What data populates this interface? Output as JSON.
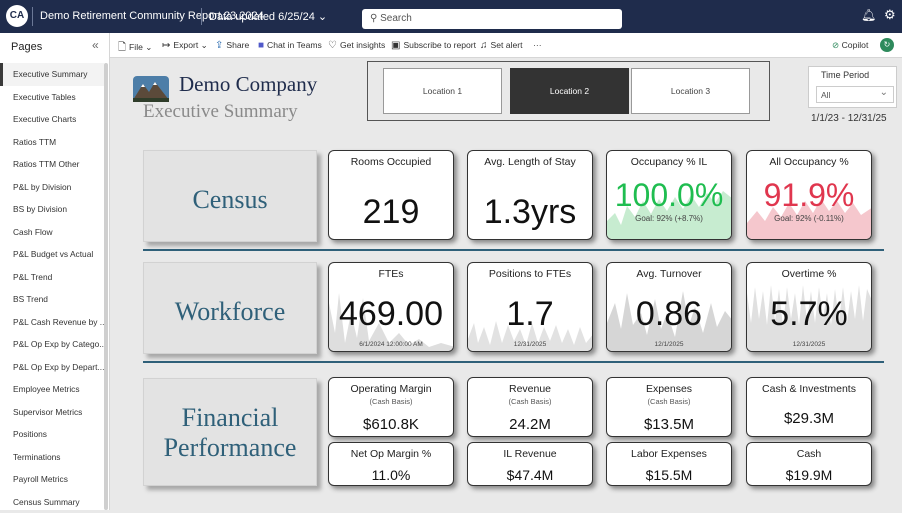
{
  "topbar": {
    "report_title": "Demo Retirement Community Report.23.2024",
    "updated": "Data updated 6/25/24",
    "search_placeholder": "Search"
  },
  "sidebar": {
    "title": "Pages",
    "items": [
      "Executive Summary",
      "Executive Tables",
      "Executive Charts",
      "Ratios TTM",
      "Ratios TTM Other",
      "P&L by Division",
      "BS by Division",
      "Cash Flow",
      "P&L Budget vs Actual",
      "P&L Trend",
      "BS Trend",
      "P&L Cash Revenue by ...",
      "P&L Op Exp by Catego...",
      "P&L Op Exp by Depart...",
      "Employee Metrics",
      "Supervisor Metrics",
      "Positions",
      "Terminations",
      "Payroll Metrics",
      "Census Summary"
    ]
  },
  "toolbar": {
    "file": "File",
    "export": "Export",
    "share": "Share",
    "teams": "Chat in Teams",
    "insights": "Get insights",
    "subscribe": "Subscribe to report",
    "alert": "Set alert",
    "more": "···",
    "copilot": "Copilot"
  },
  "header": {
    "company": "Demo Company",
    "subtitle": "Executive Summary"
  },
  "locations": [
    "Location 1",
    "Location 2",
    "Location 3"
  ],
  "selected_location": "Location 2",
  "time_period": {
    "label": "Time Period",
    "value": "All",
    "range": "1/1/23 - 12/31/25"
  },
  "sections": {
    "census": "Census",
    "workforce": "Workforce",
    "financial_1": "Financial",
    "financial_2": "Performance"
  },
  "census": {
    "rooms": {
      "title": "Rooms Occupied",
      "value": "219"
    },
    "los": {
      "title": "Avg. Length of Stay",
      "value": "1.3yrs"
    },
    "occ_il": {
      "title": "Occupancy % IL",
      "value": "100.0%",
      "goal": "Goal: 92% (+8.7%)"
    },
    "occ_all": {
      "title": "All Occupancy %",
      "value": "91.9%",
      "goal": "Goal: 92% (-0.11%)"
    }
  },
  "workforce": {
    "ftes": {
      "title": "FTEs",
      "value": "469.00",
      "date": "6/1/2024 12:00:00 AM"
    },
    "pos": {
      "title": "Positions to FTEs",
      "value": "1.7",
      "date": "12/31/2025"
    },
    "turnover": {
      "title": "Avg. Turnover",
      "value": "0.86",
      "date": "12/1/2025"
    },
    "overtime": {
      "title": "Overtime %",
      "value": "5.7%",
      "date": "12/31/2025"
    }
  },
  "financial": {
    "op_margin": {
      "title": "Operating Margin",
      "sub": "(Cash Basis)",
      "value": "$610.8K"
    },
    "revenue": {
      "title": "Revenue",
      "sub": "(Cash Basis)",
      "value": "24.2M"
    },
    "expenses": {
      "title": "Expenses",
      "sub": "(Cash Basis)",
      "value": "$13.5M"
    },
    "cash_inv": {
      "title": "Cash & Investments",
      "value": "$29.3M"
    },
    "net_op": {
      "title": "Net Op Margin %",
      "value": "11.0%"
    },
    "il_rev": {
      "title": "IL Revenue",
      "value": "$47.4M"
    },
    "labor": {
      "title": "Labor Expenses",
      "value": "$15.5M"
    },
    "cash": {
      "title": "Cash",
      "value": "$19.9M"
    }
  },
  "colors": {
    "navy": "#1f2c4c",
    "teal": "#2f6079",
    "green": "#1fbd50",
    "red": "#e0364e"
  }
}
